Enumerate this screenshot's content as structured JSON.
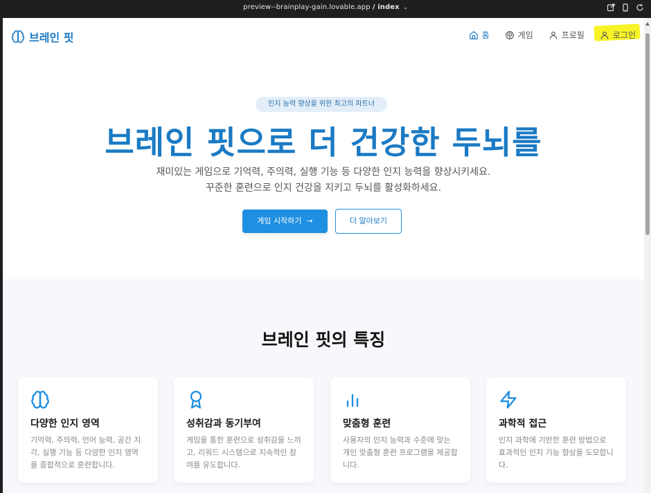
{
  "browser": {
    "url": "preview--brainplay-gain.lovable.app",
    "path": "/ index",
    "icons": [
      "external-link-icon",
      "mobile-device-icon",
      "refresh-icon"
    ]
  },
  "nav": {
    "logo_text": "브레인 핏",
    "items": [
      {
        "label": "홈",
        "icon": "home-icon",
        "active": true
      },
      {
        "label": "게임",
        "icon": "brain-icon"
      },
      {
        "label": "프로필",
        "icon": "user-icon"
      },
      {
        "label": "로그인",
        "icon": "user-icon"
      }
    ]
  },
  "hero": {
    "badge": "인지 능력 향상을 위한 최고의 파트너",
    "title": "브레인 핏으로 더 건강한 두뇌를",
    "description": "재미있는 게임으로 기억력, 주의력, 실행 기능 등 다양한 인지 능력을 향상시키세요. 꾸준한 훈련으로 인지 건강을 지키고 두뇌를 활성화하세요.",
    "primary_button": "게임 시작하기",
    "secondary_button": "더 알아보기"
  },
  "features": {
    "title": "브레인 핏의 특징",
    "cards": [
      {
        "icon": "brain-icon",
        "title": "다양한 인지 영역",
        "desc": "기억력, 주의력, 언어 능력, 공간 지각, 실행 기능 등 다양한 인지 영역을 종합적으로 훈련합니다."
      },
      {
        "icon": "award-icon",
        "title": "성취감과 동기부여",
        "desc": "게임을 통한 훈련으로 성취감을 느끼고, 리워드 시스템으로 지속적인 참여를 유도합니다."
      },
      {
        "icon": "bar-chart-icon",
        "title": "맞춤형 훈련",
        "desc": "사용자의 인지 능력과 수준에 맞는 개인 맞춤형 훈련 프로그램을 제공합니다."
      },
      {
        "icon": "lightning-icon",
        "title": "과학적 접근",
        "desc": "인지 과학에 기반한 훈련 방법으로 효과적인 인지 기능 향상을 도모합니다."
      }
    ]
  },
  "colors": {
    "primary": "#1b7ac4",
    "button": "#1f8fe1",
    "badge_bg": "#e3eef9",
    "highlight": "#f7f21a",
    "features_bg": "#f6f8fb"
  }
}
